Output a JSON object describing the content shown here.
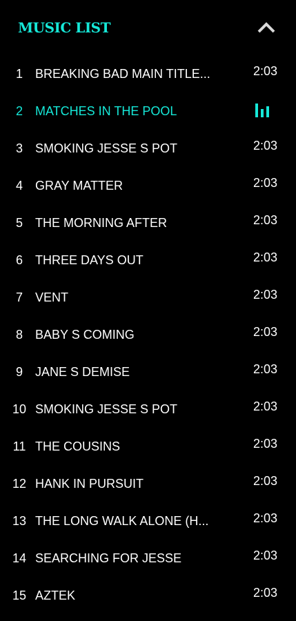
{
  "header": {
    "title": "MUSIC LIST",
    "collapse_icon": "chevron-up-icon"
  },
  "colors": {
    "background": "#000000",
    "accent": "#16e8d8",
    "text": "#ffffff"
  },
  "tracks": [
    {
      "number": "1",
      "title": "BREAKING BAD MAIN TITLE...",
      "duration": "2:03"
    },
    {
      "number": "2",
      "title": "MATCHES IN THE POOL",
      "duration": "",
      "playing": true,
      "status_icon": "equalizer-icon"
    },
    {
      "number": "3",
      "title": "SMOKING JESSE S POT",
      "duration": "2:03"
    },
    {
      "number": "4",
      "title": "GRAY MATTER",
      "duration": "2:03"
    },
    {
      "number": "5",
      "title": "THE MORNING AFTER",
      "duration": "2:03"
    },
    {
      "number": "6",
      "title": "THREE DAYS OUT",
      "duration": "2:03"
    },
    {
      "number": "7",
      "title": "VENT",
      "duration": "2:03"
    },
    {
      "number": "8",
      "title": "BABY S COMING",
      "duration": "2:03"
    },
    {
      "number": "9",
      "title": "JANE S DEMISE",
      "duration": "2:03"
    },
    {
      "number": "10",
      "title": "SMOKING JESSE S POT",
      "duration": "2:03"
    },
    {
      "number": "11",
      "title": "THE COUSINS",
      "duration": "2:03"
    },
    {
      "number": "12",
      "title": "HANK IN PURSUIT",
      "duration": "2:03"
    },
    {
      "number": "13",
      "title": "THE LONG WALK ALONE (H...",
      "duration": "2:03"
    },
    {
      "number": "14",
      "title": "SEARCHING FOR JESSE",
      "duration": "2:03"
    },
    {
      "number": "15",
      "title": "AZTEK",
      "duration": "2:03"
    }
  ]
}
